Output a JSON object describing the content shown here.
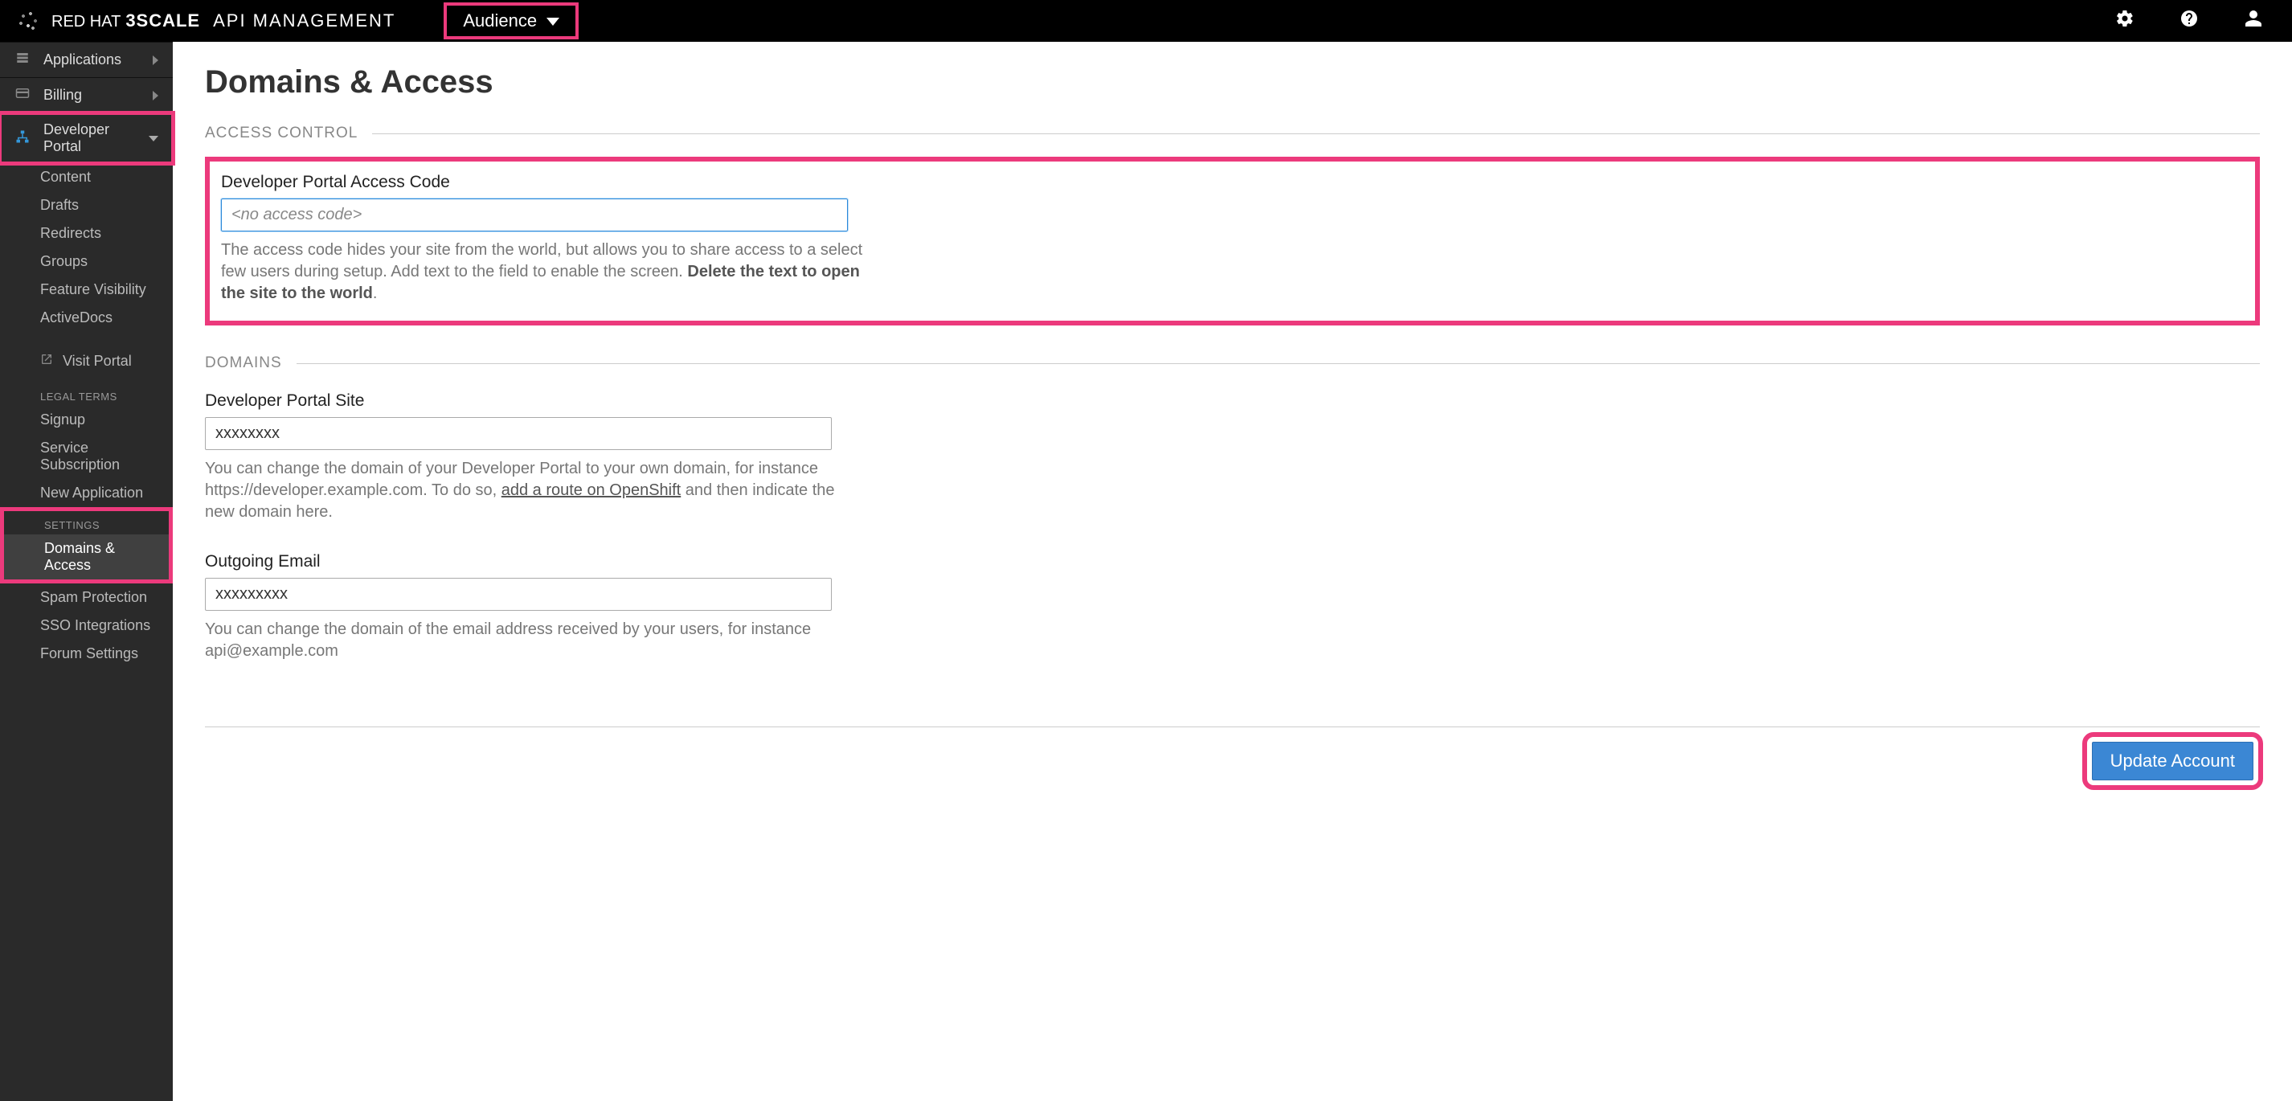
{
  "header": {
    "brand_redhat": "RED HAT",
    "brand_3scale": "3SCALE",
    "brand_api": "API MANAGEMENT",
    "nav_dropdown": "Audience"
  },
  "sidebar": {
    "applications": "Applications",
    "billing": "Billing",
    "developer_portal": "Developer Portal",
    "dev_portal_items": {
      "content": "Content",
      "drafts": "Drafts",
      "redirects": "Redirects",
      "groups": "Groups",
      "feature_visibility": "Feature Visibility",
      "activedocs": "ActiveDocs"
    },
    "visit_portal": "Visit Portal",
    "legal_terms_head": "Legal Terms",
    "legal_items": {
      "signup": "Signup",
      "service_subscription": "Service Subscription",
      "new_application": "New Application"
    },
    "settings_head": "Settings",
    "settings_items": {
      "domains_access": "Domains & Access",
      "spam_protection": "Spam Protection",
      "sso_integrations": "SSO Integrations",
      "forum_settings": "Forum Settings"
    }
  },
  "page": {
    "title": "Domains & Access",
    "access_control_head": "ACCESS CONTROL",
    "access_code": {
      "label": "Developer Portal Access Code",
      "placeholder": "<no access code>",
      "help_pre": "The access code hides your site from the world, but allows you to share access to a select few users during setup. Add text to the field to enable the screen. ",
      "help_bold": "Delete the text to open the site to the world",
      "help_post": "."
    },
    "domains_head": "DOMAINS",
    "portal_site": {
      "label": "Developer Portal Site",
      "value": "xxxxxxxx",
      "help_pre": "You can change the domain of your Developer Portal to your own domain, for instance https://developer.example.com. To do so, ",
      "help_link": "add a route on OpenShift",
      "help_post": " and then indicate the new domain here."
    },
    "outgoing_email": {
      "label": "Outgoing Email",
      "value": "xxxxxxxxx",
      "help": "You can change the domain of the email address received by your users, for instance api@example.com"
    },
    "update_button": "Update Account"
  }
}
